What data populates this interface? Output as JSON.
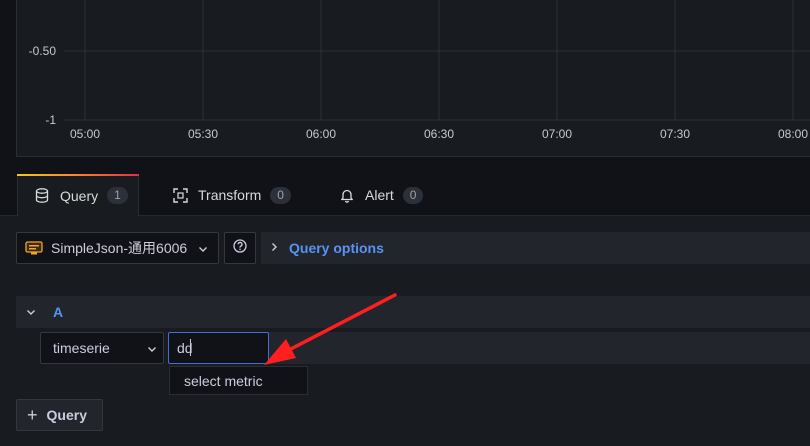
{
  "chart": {
    "y_ticks": [
      "-0.50",
      "-1"
    ],
    "x_ticks": [
      "05:00",
      "05:30",
      "06:00",
      "06:30",
      "07:00",
      "07:30",
      "08:00"
    ]
  },
  "tabs": [
    {
      "label": "Query",
      "count": "1",
      "icon": "database-icon",
      "active": true
    },
    {
      "label": "Transform",
      "count": "0",
      "icon": "transform-icon",
      "active": false
    },
    {
      "label": "Alert",
      "count": "0",
      "icon": "bell-icon",
      "active": false
    }
  ],
  "datasource": {
    "name": "SimpleJson-通用6006",
    "icon": "simplejson-datasource-icon"
  },
  "query_options": {
    "label": "Query options"
  },
  "query": {
    "ref_id": "A",
    "type_value": "timeserie",
    "target_value": "dd",
    "suggestion": "select metric"
  },
  "add_query": {
    "label": "Query"
  },
  "colors": {
    "accent": "#5794f2",
    "input_focus": "#3d71d9",
    "annotation_arrow": "#ff1f1f",
    "tab_gradient": [
      "#f2cc0c",
      "#ff8833",
      "#e02f44"
    ]
  }
}
